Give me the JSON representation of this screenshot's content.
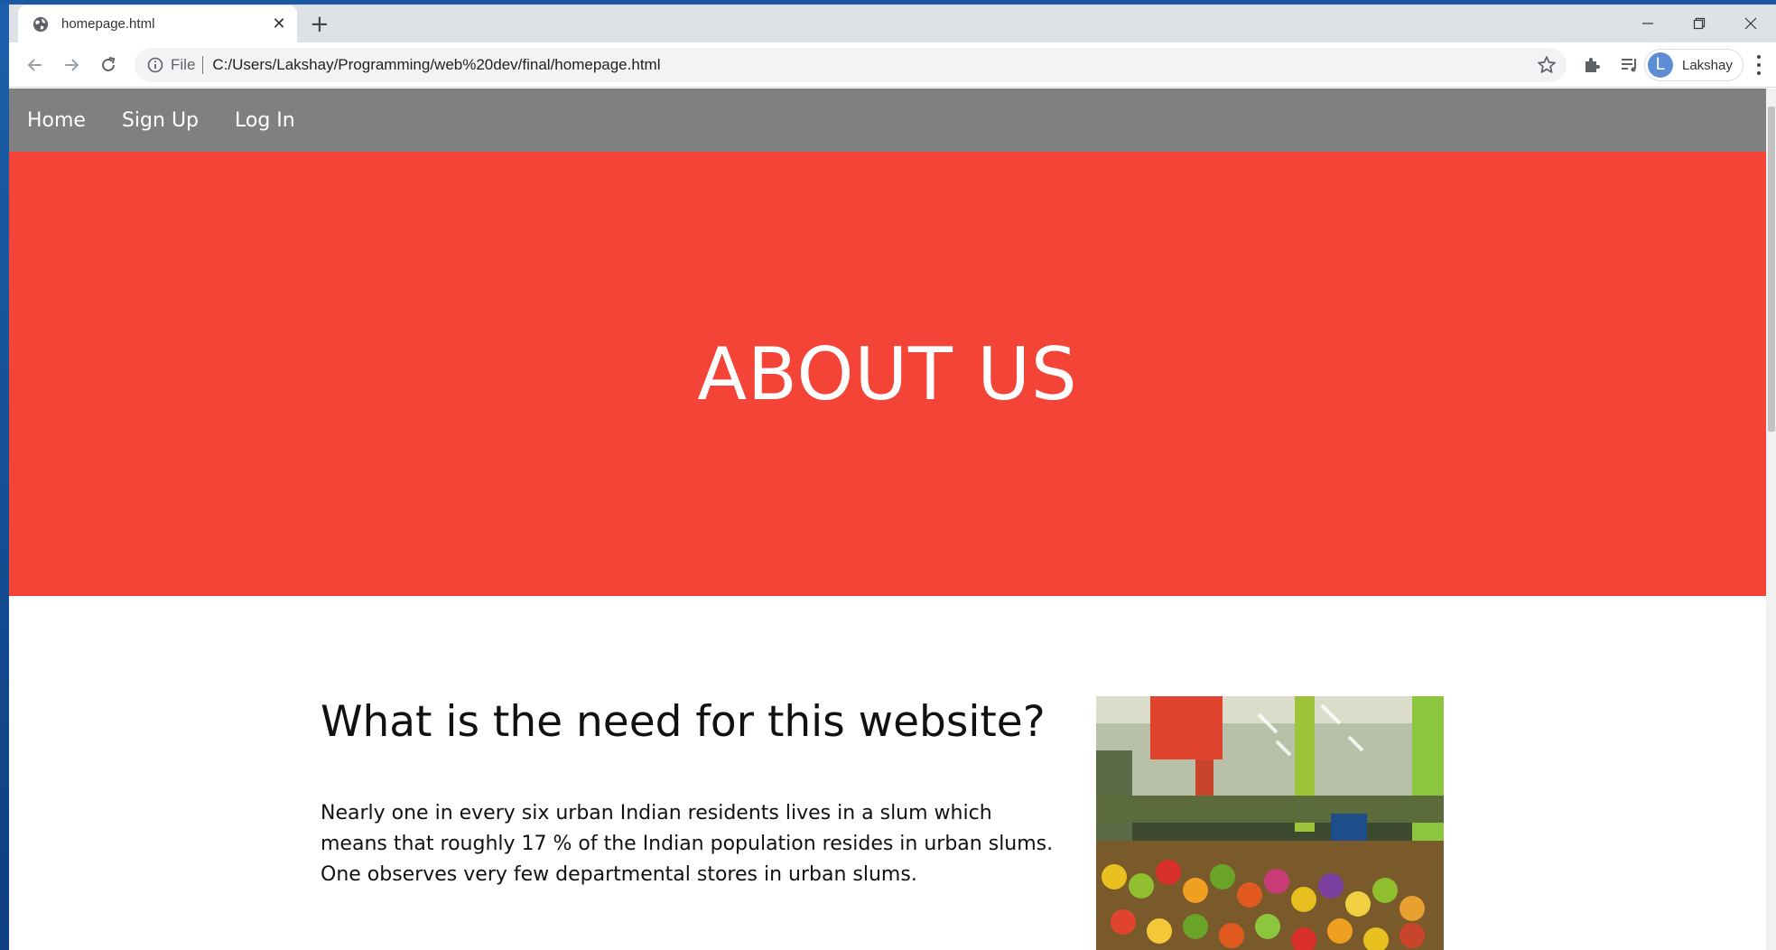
{
  "browser": {
    "tab_title": "homepage.html",
    "url_scheme": "File",
    "url": "C:/Users/Lakshay/Programming/web%20dev/final/homepage.html",
    "profile_initial": "L",
    "profile_name": "Lakshay"
  },
  "nav": {
    "items": [
      {
        "label": "Home"
      },
      {
        "label": "Sign Up"
      },
      {
        "label": "Log In"
      }
    ]
  },
  "hero": {
    "title": "ABOUT US",
    "background": "#f44437"
  },
  "section": {
    "heading": "What is the need for this website?",
    "paragraph": "Nearly one in every six urban Indian residents lives in a slum which means that roughly 17 % of the Indian population resides in urban slums. One observes very few departmental stores in urban slums."
  },
  "icons": {
    "favicon": "globe-icon",
    "back": "back-arrow-icon",
    "forward": "forward-arrow-icon",
    "reload": "reload-icon",
    "info": "info-icon",
    "bookmark": "star-icon",
    "extensions": "puzzle-icon",
    "reading_list": "playlist-icon",
    "menu": "kebab-menu-icon"
  }
}
